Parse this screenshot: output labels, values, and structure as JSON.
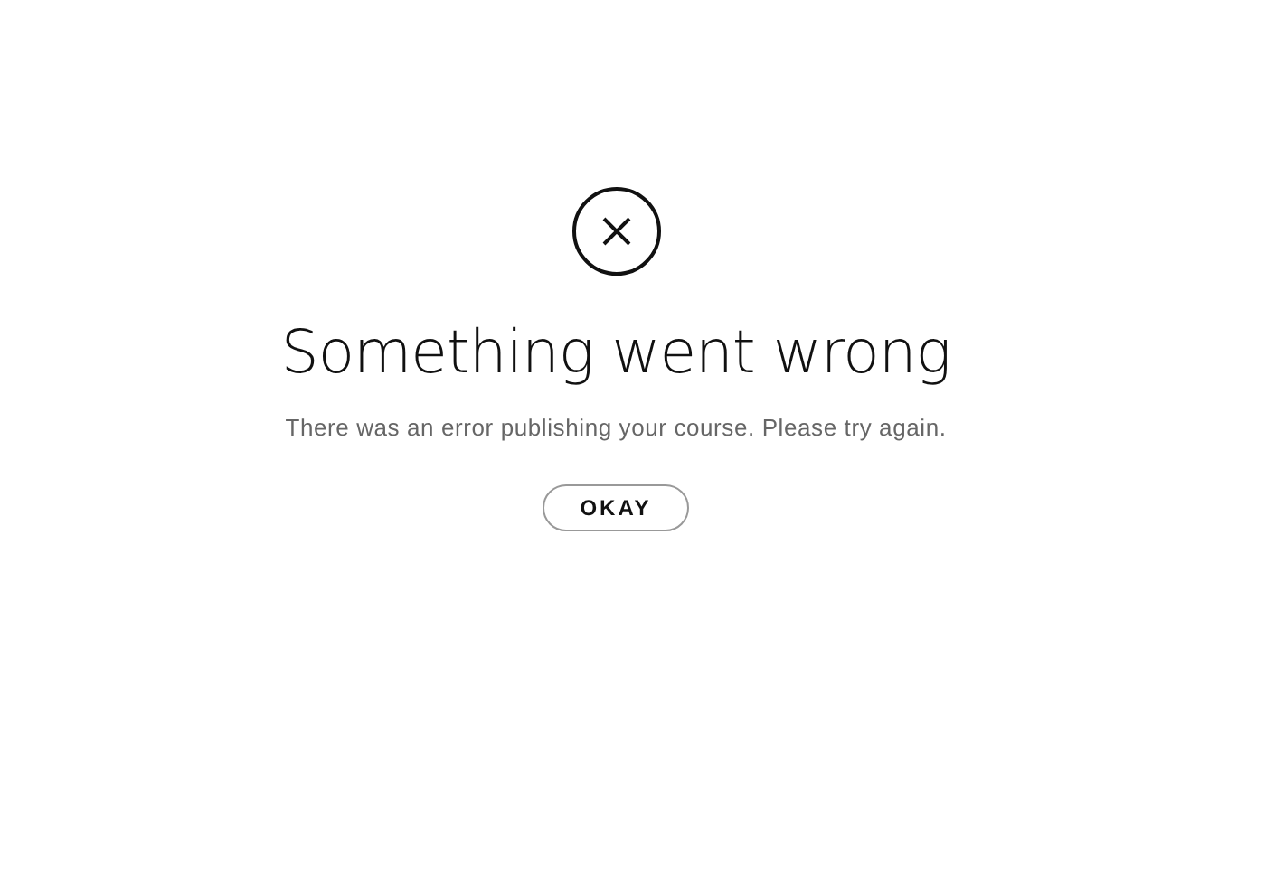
{
  "dialog": {
    "title": "Something went wrong",
    "message": "There was an error publishing your course. Please try again.",
    "button": "OKAY"
  }
}
